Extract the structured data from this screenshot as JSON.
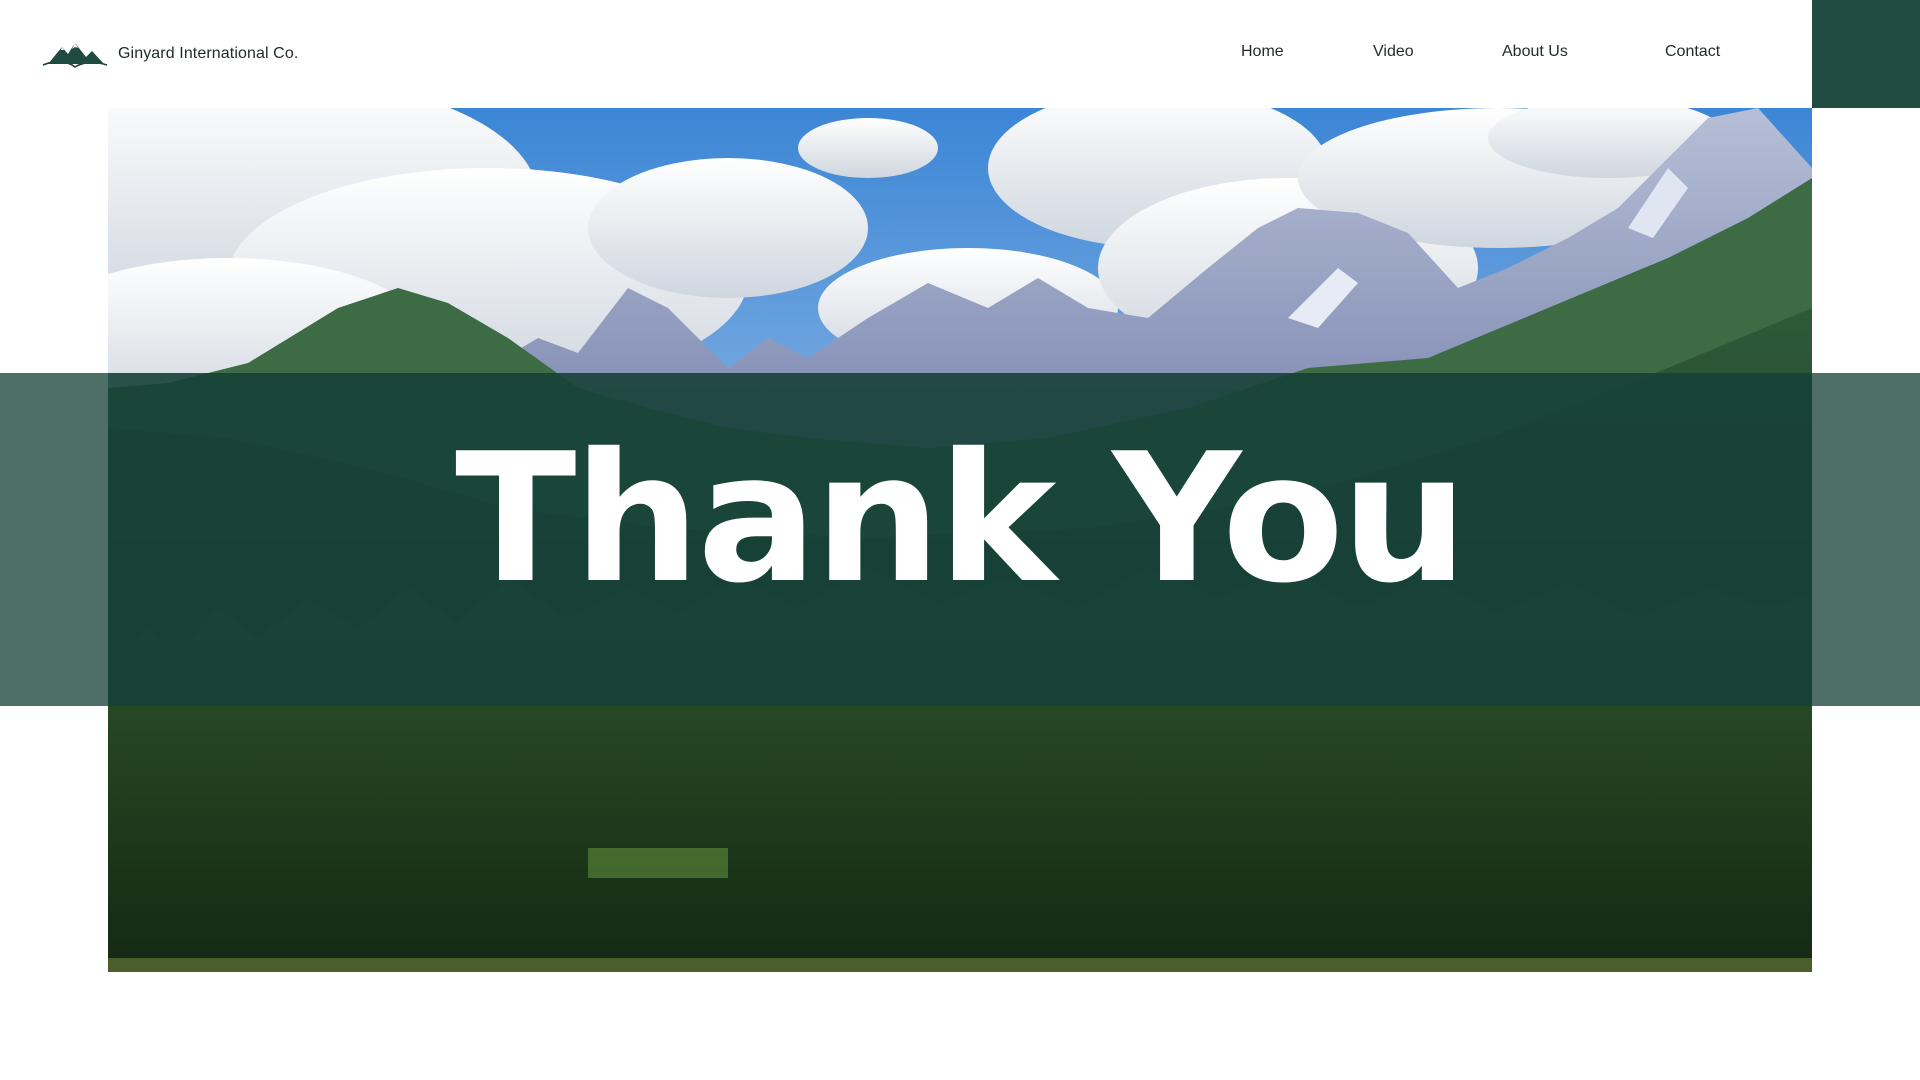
{
  "header": {
    "brand_name": "Ginyard International Co.",
    "logo_icon": "mountain-logo-icon"
  },
  "nav": {
    "items": [
      {
        "label": "Home"
      },
      {
        "label": "Video"
      },
      {
        "label": "About Us"
      },
      {
        "label": "Contact"
      }
    ]
  },
  "hero": {
    "headline": "Thank You",
    "image": "mountain-landscape"
  },
  "colors": {
    "accent": "#204c42",
    "band": "#1b463e",
    "text_dark": "#1f2b2a",
    "headline": "#ffffff"
  }
}
